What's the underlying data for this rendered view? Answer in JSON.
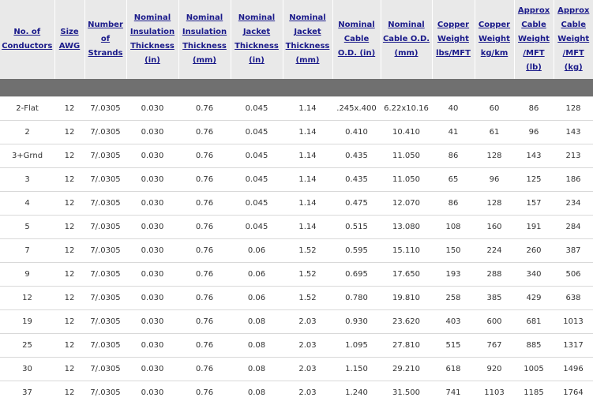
{
  "table": {
    "headers": [
      "No. of Conductors",
      "Size AWG",
      "Number of Strands",
      "Nominal Insulation Thickness (in)",
      "Nominal Insulation Thickness (mm)",
      "Nominal Jacket Thickness (in)",
      "Nominal Jacket Thickness (mm)",
      "Nominal Cable O.D. (in)",
      "Nominal Cable O.D. (mm)",
      "Copper Weight lbs/MFT",
      "Copper Weight kg/km",
      "Approx Cable Weight /MFT (lb)",
      "Approx Cable Weight /MFT (kg)"
    ],
    "rows": [
      [
        "2-Flat",
        "12",
        "7/.0305",
        "0.030",
        "0.76",
        "0.045",
        "1.14",
        ".245x.400",
        "6.22x10.16",
        "40",
        "60",
        "86",
        "128"
      ],
      [
        "2",
        "12",
        "7/.0305",
        "0.030",
        "0.76",
        "0.045",
        "1.14",
        "0.410",
        "10.410",
        "41",
        "61",
        "96",
        "143"
      ],
      [
        "3+Grnd",
        "12",
        "7/.0305",
        "0.030",
        "0.76",
        "0.045",
        "1.14",
        "0.435",
        "11.050",
        "86",
        "128",
        "143",
        "213"
      ],
      [
        "3",
        "12",
        "7/.0305",
        "0.030",
        "0.76",
        "0.045",
        "1.14",
        "0.435",
        "11.050",
        "65",
        "96",
        "125",
        "186"
      ],
      [
        "4",
        "12",
        "7/.0305",
        "0.030",
        "0.76",
        "0.045",
        "1.14",
        "0.475",
        "12.070",
        "86",
        "128",
        "157",
        "234"
      ],
      [
        "5",
        "12",
        "7/.0305",
        "0.030",
        "0.76",
        "0.045",
        "1.14",
        "0.515",
        "13.080",
        "108",
        "160",
        "191",
        "284"
      ],
      [
        "7",
        "12",
        "7/.0305",
        "0.030",
        "0.76",
        "0.06",
        "1.52",
        "0.595",
        "15.110",
        "150",
        "224",
        "260",
        "387"
      ],
      [
        "9",
        "12",
        "7/.0305",
        "0.030",
        "0.76",
        "0.06",
        "1.52",
        "0.695",
        "17.650",
        "193",
        "288",
        "340",
        "506"
      ],
      [
        "12",
        "12",
        "7/.0305",
        "0.030",
        "0.76",
        "0.06",
        "1.52",
        "0.780",
        "19.810",
        "258",
        "385",
        "429",
        "638"
      ],
      [
        "19",
        "12",
        "7/.0305",
        "0.030",
        "0.76",
        "0.08",
        "2.03",
        "0.930",
        "23.620",
        "403",
        "600",
        "681",
        "1013"
      ],
      [
        "25",
        "12",
        "7/.0305",
        "0.030",
        "0.76",
        "0.08",
        "2.03",
        "1.095",
        "27.810",
        "515",
        "767",
        "885",
        "1317"
      ],
      [
        "30",
        "12",
        "7/.0305",
        "0.030",
        "0.76",
        "0.08",
        "2.03",
        "1.150",
        "29.210",
        "618",
        "920",
        "1005",
        "1496"
      ],
      [
        "37",
        "12",
        "7/.0305",
        "0.030",
        "0.76",
        "0.08",
        "2.03",
        "1.240",
        "31.500",
        "741",
        "1103",
        "1185",
        "1764"
      ]
    ]
  }
}
